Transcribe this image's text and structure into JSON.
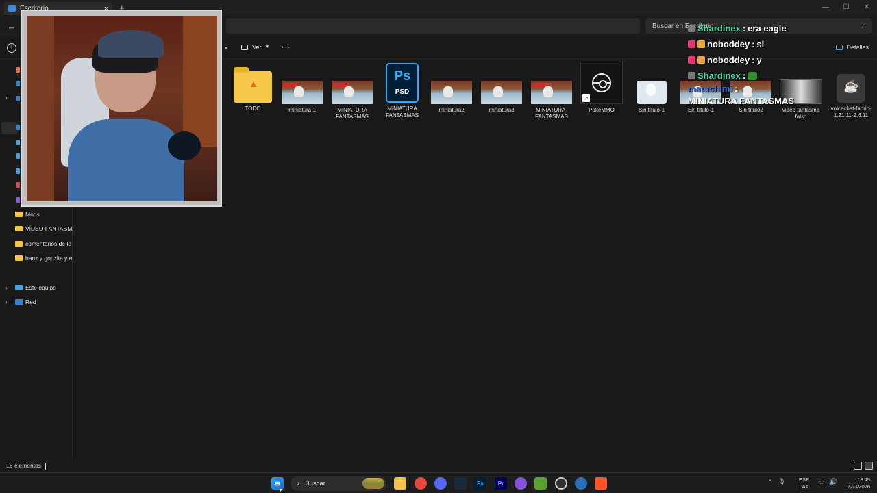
{
  "window": {
    "tab_title": "Escritorio",
    "tab_close": "×",
    "new_tab": "+",
    "controls": [
      "—",
      "☐",
      "✕"
    ]
  },
  "toolbar": {
    "back": "←",
    "search_placeholder": "Buscar en Escritorio",
    "search_icon": "⌕",
    "new": "+",
    "view_label": "Ver",
    "more": "⋯",
    "details_label": "Detalles"
  },
  "sidebar": {
    "folders": [
      {
        "label": "Mods"
      },
      {
        "label": "VÍDEO FANTASMA"
      },
      {
        "label": "comentarios de la g"
      },
      {
        "label": "hanz y gonzita y eri"
      }
    ],
    "this_pc": "Este equipo",
    "network": "Red"
  },
  "files": [
    {
      "name": "TODO",
      "icon": "folder-icon"
    },
    {
      "name": "miniatura 1",
      "icon": "image-thumbnail"
    },
    {
      "name": "MINIATURA FANTASMAS",
      "icon": "image-thumbnail"
    },
    {
      "name": "MINIATURA FANTASMAS",
      "icon": "photoshop-psd-icon",
      "ps_label": "Ps",
      "psd_label": "PSD"
    },
    {
      "name": "miniatura2",
      "icon": "image-thumbnail"
    },
    {
      "name": "miniatura3",
      "icon": "image-thumbnail"
    },
    {
      "name": "MINIATURA-FANTASMAS",
      "icon": "image-thumbnail"
    },
    {
      "name": "PokeMMO",
      "icon": "pokeball-shortcut-icon"
    },
    {
      "name": "Sin título-1",
      "icon": "image-thumbnail"
    },
    {
      "name": "Sin título-1",
      "icon": "image-thumbnail"
    },
    {
      "name": "Sin título2",
      "icon": "image-thumbnail"
    },
    {
      "name": "video fantasma falso",
      "icon": "video-thumbnail"
    },
    {
      "name": "voicechat-fabric-1.21.11-2.6.11",
      "icon": "java-jar-icon"
    }
  ],
  "chat": {
    "messages": [
      {
        "user": "Shardinex",
        "sep": ":",
        "text": "era eagle"
      },
      {
        "user": "noboddey",
        "sep": ":",
        "text": "si"
      },
      {
        "user": "noboddey",
        "sep": ":",
        "text": "y"
      },
      {
        "user": "Shardinex",
        "sep": ":",
        "text": ""
      },
      {
        "user": "matuchimi",
        "sep": ":",
        "text": "MINIATURA FANTASMAS"
      }
    ],
    "colors": {
      "green": "#4bd8a0",
      "white": "#ffffff",
      "blue": "#3a74e0"
    }
  },
  "status": {
    "count": "16 elementos"
  },
  "taskbar": {
    "search_label": "Buscar",
    "search_icon": "⌕",
    "apps": [
      "file-explorer-icon",
      "chrome-icon",
      "discord-icon",
      "steam-icon",
      "photoshop-icon",
      "premiere-icon",
      "app-icon",
      "minecraft-icon",
      "obs-icon",
      "ccleaner-icon",
      "brave-icon"
    ],
    "tray_chevron": "^",
    "lang_top": "ESP",
    "lang_bottom": "LAA",
    "time": "13:45",
    "date": "22/3/2026"
  }
}
